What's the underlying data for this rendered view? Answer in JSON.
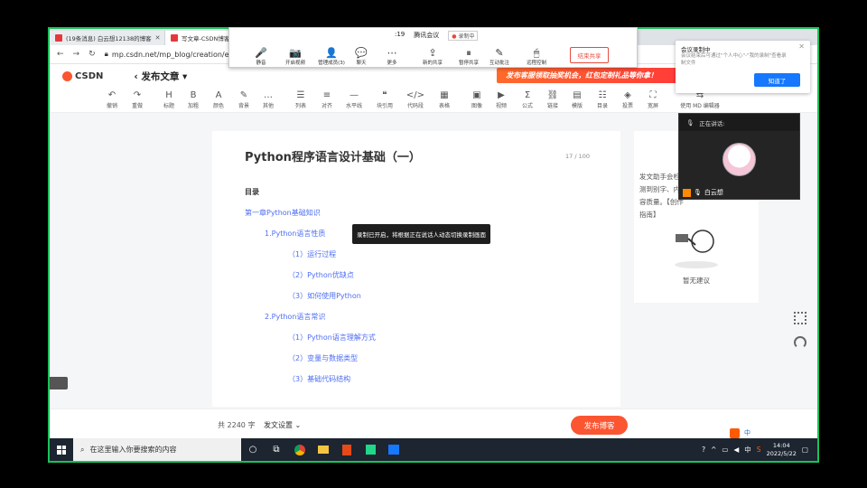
{
  "browser": {
    "tabs": [
      {
        "label": "(19条消息) 白云想12138的博客",
        "close": "✕"
      },
      {
        "label": "写文章-CSDN博客",
        "close": "✕"
      }
    ],
    "url": "mp.csdn.net/mp_blog/creation/e"
  },
  "csdn": {
    "logo": "CSDN",
    "page_title": "发布文章",
    "banner": "发布客服领取抽奖机会，红包定制礼品等你拿！"
  },
  "toolbar": {
    "items": [
      {
        "icon": "↶",
        "label": "撤销"
      },
      {
        "icon": "↷",
        "label": "重做"
      },
      {
        "icon": "H",
        "label": "标题"
      },
      {
        "icon": "B",
        "label": "加粗"
      },
      {
        "icon": "A",
        "label": "颜色"
      },
      {
        "icon": "✎",
        "label": "背景"
      },
      {
        "icon": "…",
        "label": "其他"
      },
      {
        "icon": "☰",
        "label": "列表"
      },
      {
        "icon": "≡",
        "label": "对齐"
      },
      {
        "icon": "—",
        "label": "水平线"
      },
      {
        "icon": "❝",
        "label": "块引用"
      },
      {
        "icon": "</>",
        "label": "代码段"
      },
      {
        "icon": "▦",
        "label": "表格"
      },
      {
        "icon": "▣",
        "label": "图像"
      },
      {
        "icon": "▶",
        "label": "视频"
      },
      {
        "icon": "Σ",
        "label": "公式"
      },
      {
        "icon": "⛓",
        "label": "链接"
      },
      {
        "icon": "▤",
        "label": "模版"
      },
      {
        "icon": "☷",
        "label": "目录"
      },
      {
        "icon": "◈",
        "label": "投票"
      },
      {
        "icon": "⛶",
        "label": "宽屏"
      },
      {
        "icon": "⇆",
        "label": "使用 MD 编辑器"
      }
    ]
  },
  "document": {
    "title": "Python程序语言设计基础（一）",
    "char_count": "17 / 100",
    "toc_heading": "目录",
    "toc": [
      "第一章Python基础知识",
      "1.Python语言性质",
      "（1）运行过程",
      "（2）Python优缺点",
      "（3）如何使用Python",
      "2.Python语言常识",
      "（1）Python语言理解方式",
      "（2）变量与数据类型",
      "（3）基础代码结构"
    ]
  },
  "side_panel": {
    "text": "发文助手会检测到别字、内容质量。【创作指南】",
    "empty": "暂无建议"
  },
  "footer": {
    "word_count": "共 2240 字",
    "doc_settings": "发文设置",
    "publish": "发布博客"
  },
  "taskbar": {
    "search_placeholder": "在这里输入你要搜索的内容",
    "ime": "中",
    "time": "14:04",
    "date": "2022/5/22"
  },
  "meeting": {
    "timer": ":19",
    "title": "腾讯会议",
    "recording": "录制中",
    "tools": [
      {
        "icon": "🎤",
        "label": "静音"
      },
      {
        "icon": "📷",
        "label": "开启视频"
      },
      {
        "icon": "👤",
        "label": "管理成员(3)"
      },
      {
        "icon": "💬",
        "label": "聊天"
      },
      {
        "icon": "⋯",
        "label": "更多"
      },
      {
        "icon": "⇪",
        "label": "新的共享"
      },
      {
        "icon": "⏸",
        "label": "暂停共享"
      },
      {
        "icon": "✎",
        "label": "互动批注"
      },
      {
        "icon": "🖱",
        "label": "远程控制"
      }
    ],
    "stop_share": "结束共享",
    "rec_popup": {
      "title": "会议录制中",
      "desc": "会议结束后可通过\"个人中心\"-\"我的录制\"查看录制文件",
      "ok": "知道了",
      "close": "✕"
    },
    "speaker_label": "正在讲话:",
    "speaker_name": "白云想",
    "tooltip": "录制已开启，将根据正在说话人动态切换录制画面"
  }
}
